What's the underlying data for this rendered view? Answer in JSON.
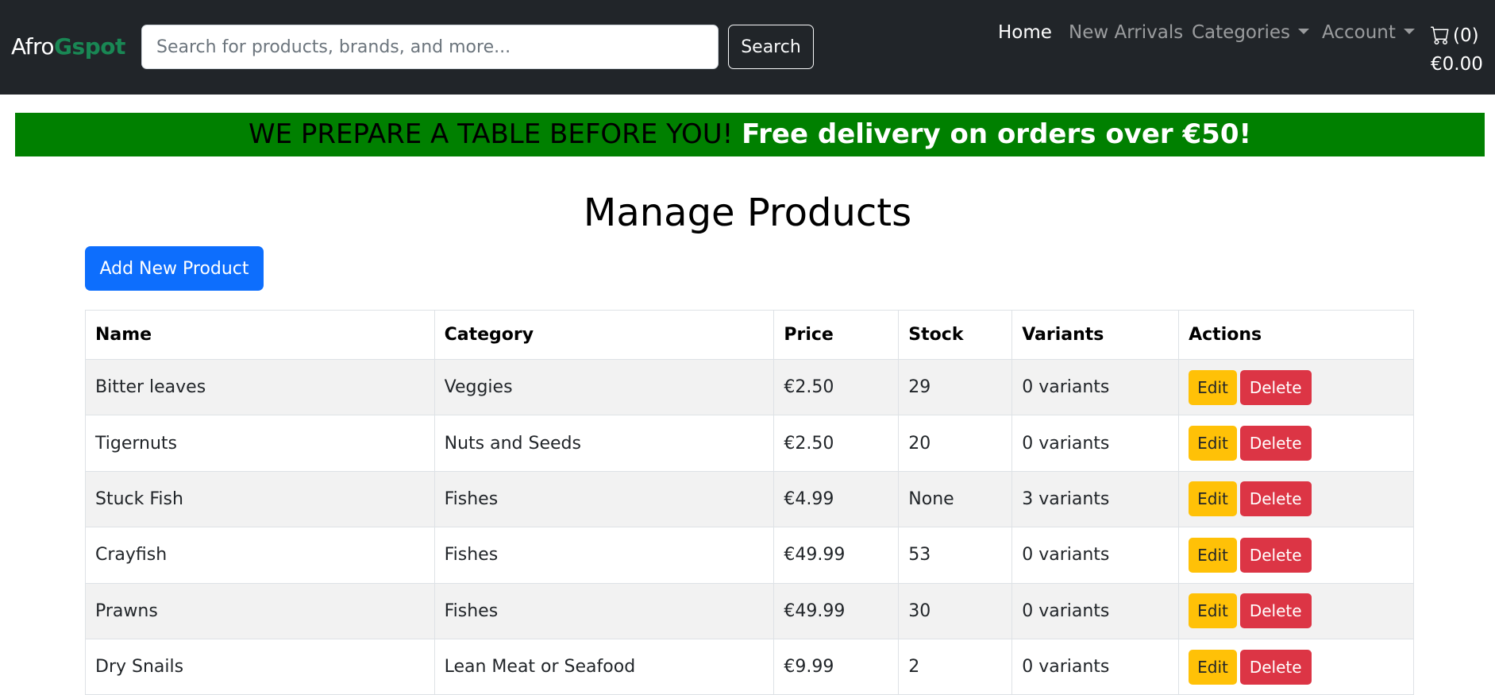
{
  "navbar": {
    "brand_part1": "Afro",
    "brand_part2": "Gspot",
    "search_placeholder": "Search for products, brands, and more...",
    "search_button": "Search",
    "links": {
      "home": "Home",
      "new_arrivals": "New Arrivals",
      "categories": "Categories",
      "account": "Account"
    },
    "cart_count": "(0)",
    "cart_total": "€0.00"
  },
  "promo": {
    "part1": "WE PREPARE A TABLE BEFORE YOU!",
    "part2": "Free delivery on orders over €50!"
  },
  "page": {
    "title": "Manage Products",
    "add_button": "Add New Product"
  },
  "table": {
    "headers": {
      "name": "Name",
      "category": "Category",
      "price": "Price",
      "stock": "Stock",
      "variants": "Variants",
      "actions": "Actions"
    },
    "edit_label": "Edit",
    "delete_label": "Delete",
    "rows": [
      {
        "name": "Bitter leaves",
        "category": "Veggies",
        "price": "€2.50",
        "stock": "29",
        "variants": "0 variants"
      },
      {
        "name": "Tigernuts",
        "category": "Nuts and Seeds",
        "price": "€2.50",
        "stock": "20",
        "variants": "0 variants"
      },
      {
        "name": "Stuck Fish",
        "category": "Fishes",
        "price": "€4.99",
        "stock": "None",
        "variants": "3 variants"
      },
      {
        "name": "Crayfish",
        "category": "Fishes",
        "price": "€49.99",
        "stock": "53",
        "variants": "0 variants"
      },
      {
        "name": "Prawns",
        "category": "Fishes",
        "price": "€49.99",
        "stock": "30",
        "variants": "0 variants"
      },
      {
        "name": "Dry Snails",
        "category": "Lean Meat or Seafood",
        "price": "€9.99",
        "stock": "2",
        "variants": "0 variants"
      }
    ]
  },
  "colors": {
    "navbar_bg": "#212529",
    "brand_accent": "#198754",
    "promo_bg": "#008000",
    "primary": "#0d6efd",
    "warning": "#ffc107",
    "danger": "#dc3545"
  },
  "icons": {
    "cart": "cart-icon",
    "caret": "chevron-down-icon"
  }
}
